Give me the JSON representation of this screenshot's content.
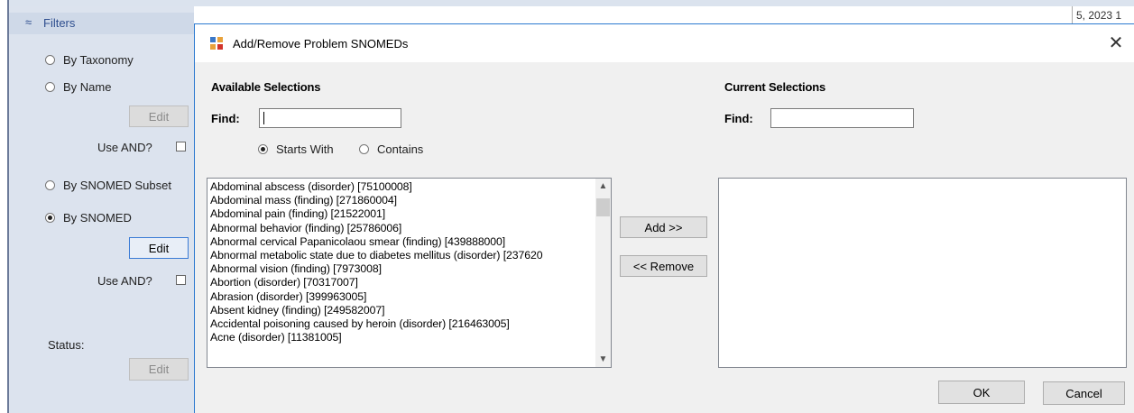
{
  "background": {
    "filters_header": "Filters",
    "date_partial": "5, 2023 1",
    "radio_by_taxonomy": "By Taxonomy",
    "radio_by_name": "By Name",
    "edit_button_1": "Edit",
    "use_and_1": "Use AND?",
    "radio_by_snomed_subset": "By SNOMED Subset",
    "radio_by_snomed": "By SNOMED",
    "edit_button_2": "Edit",
    "use_and_2": "Use AND?",
    "status_label": "Status:",
    "edit_button_3": "Edit",
    "selected_radio": "By SNOMED"
  },
  "dialog": {
    "title": "Add/Remove Problem SNOMEDs",
    "close_label": "✕",
    "available": {
      "heading": "Available Selections",
      "find_label": "Find:",
      "find_value": "",
      "mode_starts_with": "Starts With",
      "mode_contains": "Contains",
      "selected_mode": "Starts With",
      "items": [
        "Abdominal abscess (disorder) [75100008]",
        "Abdominal mass (finding) [271860004]",
        "Abdominal pain (finding) [21522001]",
        "Abnormal behavior (finding) [25786006]",
        "Abnormal cervical Papanicolaou smear (finding) [439888000]",
        "Abnormal metabolic state due to diabetes mellitus (disorder) [237620",
        "Abnormal vision (finding) [7973008]",
        "Abortion (disorder) [70317007]",
        "Abrasion (disorder) [399963005]",
        "Absent kidney (finding) [249582007]",
        "Accidental poisoning caused by heroin (disorder) [216463005]",
        "Acne (disorder) [11381005]"
      ]
    },
    "current": {
      "heading": "Current Selections",
      "find_label": "Find:",
      "find_value": "",
      "items": []
    },
    "add_button": "Add >>",
    "remove_button": "<< Remove",
    "ok_button": "OK",
    "cancel_button": "Cancel"
  }
}
